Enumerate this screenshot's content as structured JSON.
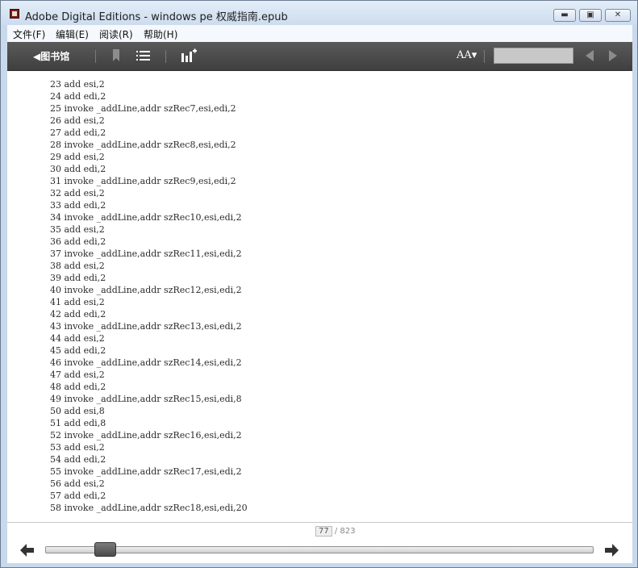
{
  "window": {
    "title": "Adobe Digital Editions - windows pe 权威指南.epub",
    "minimize_glyph": "▬",
    "maximize_glyph": "▣",
    "close_glyph": "✕"
  },
  "menu": {
    "items": [
      "文件(F)",
      "编辑(E)",
      "阅读(R)",
      "帮助(H)"
    ]
  },
  "toolbar": {
    "library_label": "◀图书馆",
    "font_size_label": "AA▾",
    "search_value": "",
    "icons": [
      "bookmark-icon",
      "list-icon",
      "add-chart-icon",
      "font-size-icon",
      "prev-arrow-icon",
      "next-arrow-icon"
    ],
    "colors": {
      "background": "#4a4a4a",
      "text": "#ffffff"
    }
  },
  "content": {
    "lines": [
      "23 add esi,2",
      "24 add edi,2",
      "25 invoke _addLine,addr szRec7,esi,edi,2",
      "26 add esi,2",
      "27 add edi,2",
      "28 invoke _addLine,addr szRec8,esi,edi,2",
      "29 add esi,2",
      "30 add edi,2",
      "31 invoke _addLine,addr szRec9,esi,edi,2",
      "32 add esi,2",
      "33 add edi,2",
      "34 invoke _addLine,addr szRec10,esi,edi,2",
      "35 add esi,2",
      "36 add edi,2",
      "37 invoke _addLine,addr szRec11,esi,edi,2",
      "38 add esi,2",
      "39 add edi,2",
      "40 invoke _addLine,addr szRec12,esi,edi,2",
      "41 add esi,2",
      "42 add edi,2",
      "43 invoke _addLine,addr szRec13,esi,edi,2",
      "44 add esi,2",
      "45 add edi,2",
      "46 invoke _addLine,addr szRec14,esi,edi,2",
      "47 add esi,2",
      "48 add edi,2",
      "49 invoke _addLine,addr szRec15,esi,edi,8",
      "50 add esi,8",
      "51 add edi,8",
      "52 invoke _addLine,addr szRec16,esi,edi,2",
      "53 add esi,2",
      "54 add edi,2",
      "55 invoke _addLine,addr szRec17,esi,edi,2",
      "56 add esi,2",
      "57 add edi,2",
      "58 invoke _addLine,addr szRec18,esi,edi,20"
    ]
  },
  "footer": {
    "current_page": "77",
    "total_pages": "/ 823",
    "progress_fraction": 0.0935
  }
}
